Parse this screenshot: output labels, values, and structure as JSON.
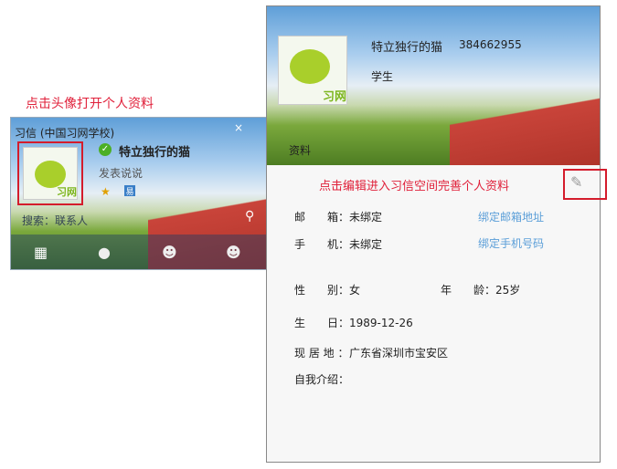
{
  "annotation_left": "点击头像打开个人资料",
  "mini": {
    "title": "习信 (中国习网学校)",
    "name": "特立独行的猫",
    "status": "发表说说",
    "search_placeholder": "搜索：联系人",
    "logo_text": "习网",
    "badge": "易"
  },
  "profile": {
    "name": "特立独行的猫",
    "id": "384662955",
    "role": "学生",
    "tab": "资料",
    "logo_text": "习网",
    "annotation": "点击编辑进入习信空间完善个人资料",
    "fields": {
      "email_label": "邮　　箱：",
      "email": "未绑定",
      "email_link": "绑定邮箱地址",
      "phone_label": "手　　机：",
      "phone": "未绑定",
      "phone_link": "绑定手机号码",
      "gender_label": "性　　别：",
      "gender": "女",
      "age_label": "年　　龄：",
      "age": "25岁",
      "birthday_label": "生　　日：",
      "birthday": "1989-12-26",
      "residence_label": "现 居 地 ：",
      "residence": "广东省深圳市宝安区",
      "intro_label": "自我介绍："
    }
  }
}
